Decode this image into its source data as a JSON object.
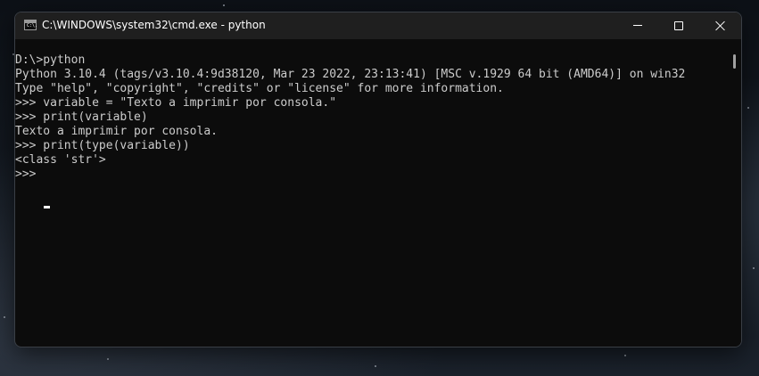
{
  "window": {
    "title": "C:\\WINDOWS\\system32\\cmd.exe - python",
    "app_icon_label": "C:\\."
  },
  "console": {
    "lines": [
      "D:\\>python",
      "Python 3.10.4 (tags/v3.10.4:9d38120, Mar 23 2022, 23:13:41) [MSC v.1929 64 bit (AMD64)] on win32",
      "Type \"help\", \"copyright\", \"credits\" or \"license\" for more information.",
      ">>> variable = \"Texto a imprimir por consola.\"",
      ">>> print(variable)",
      "Texto a imprimir por consola.",
      ">>> print(type(variable))",
      "<class 'str'>",
      ">>> "
    ]
  },
  "icons": {
    "app": "cmd-icon",
    "minimize": "minimize-icon",
    "maximize": "maximize-icon",
    "close": "close-icon"
  },
  "colors": {
    "console_background": "#0c0c0c",
    "console_text": "#cccccc",
    "titlebar": "#1f1f1f"
  }
}
